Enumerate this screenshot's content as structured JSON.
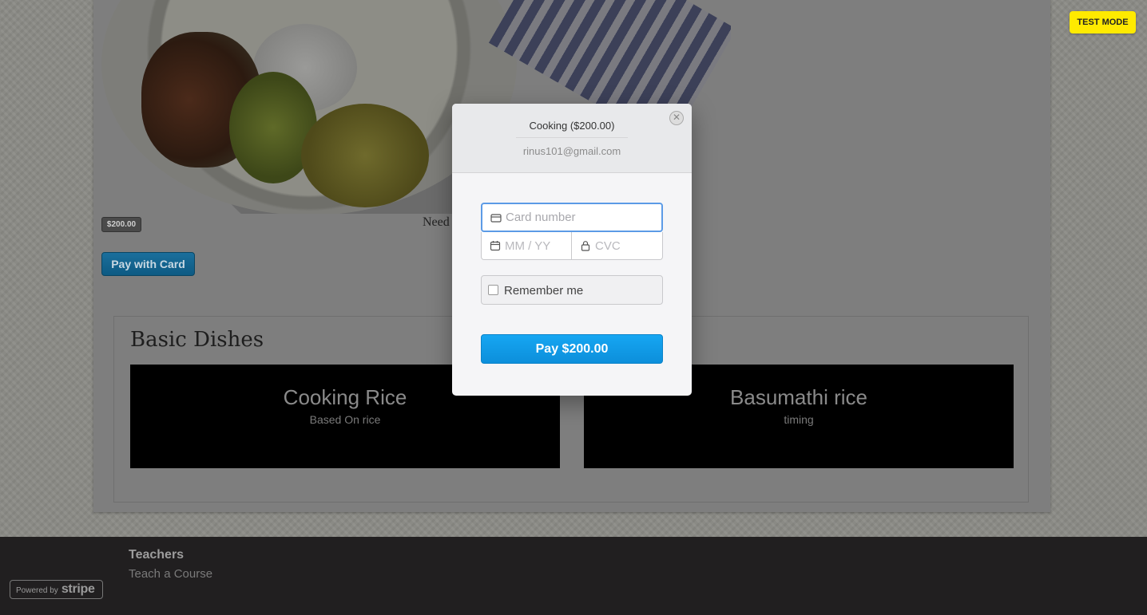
{
  "listing": {
    "price_badge": "$200.00",
    "description_partial": "Need",
    "pay_with_card_label": "Pay with Card"
  },
  "section": {
    "title": "Basic Dishes",
    "dishes": [
      {
        "title": "Cooking Rice",
        "subtitle": "Based On rice"
      },
      {
        "title": "Basumathi rice",
        "subtitle": "timing"
      }
    ]
  },
  "footer": {
    "heading": "Teachers",
    "link": "Teach a Course",
    "stripe_badge": {
      "prefix": "Powered by",
      "brand": "stripe"
    }
  },
  "test_mode_label": "TEST MODE",
  "checkout": {
    "title": "Cooking ($200.00)",
    "email": "rinus101@gmail.com",
    "card_number_placeholder": "Card number",
    "expiry_placeholder": "MM / YY",
    "cvc_placeholder": "CVC",
    "remember_label": "Remember me",
    "pay_label": "Pay $200.00",
    "close_glyph": "✕"
  },
  "colors": {
    "pay_button": "#0f98e3",
    "focus_border": "#5c9be6",
    "test_mode_bg": "#ffea00",
    "footer_bg": "#211f20"
  },
  "icons": [
    "card-icon",
    "calendar-icon",
    "lock-icon",
    "close-icon"
  ]
}
